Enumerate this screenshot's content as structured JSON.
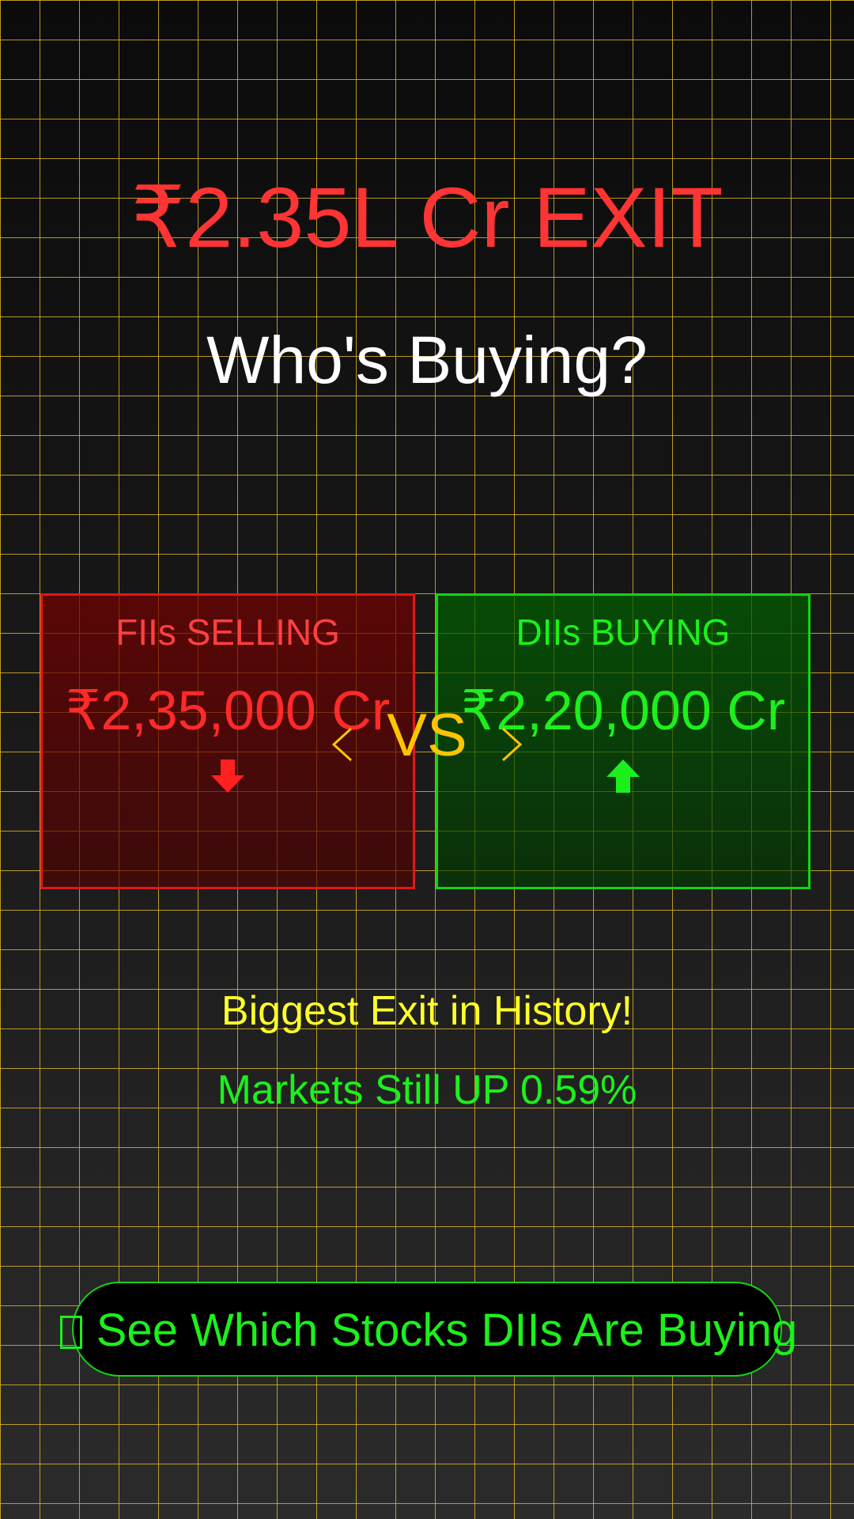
{
  "headline": "₹2.35L Cr EXIT",
  "subheadline": "Who's Buying?",
  "comparison": {
    "fii": {
      "label": "FIIs SELLING",
      "amount": "₹2,35,000 Cr",
      "direction_icon": "arrow-down-icon",
      "color": "#ff2a2a"
    },
    "vs_label": "VS",
    "dii": {
      "label": "DIIs BUYING",
      "amount": "₹2,20,000 Cr",
      "direction_icon": "arrow-up-icon",
      "color": "#1cf01c"
    }
  },
  "notes": {
    "biggest_exit": "Biggest Exit in History!",
    "markets_up": "Markets Still UP 0.59%"
  },
  "cta": {
    "label": "See Which Stocks DIIs Are Buying",
    "icon": "missing-glyph-icon"
  },
  "colors": {
    "grid": "#d7af28",
    "accent_vs": "#ffc400",
    "note_yellow": "#ffff2a"
  }
}
